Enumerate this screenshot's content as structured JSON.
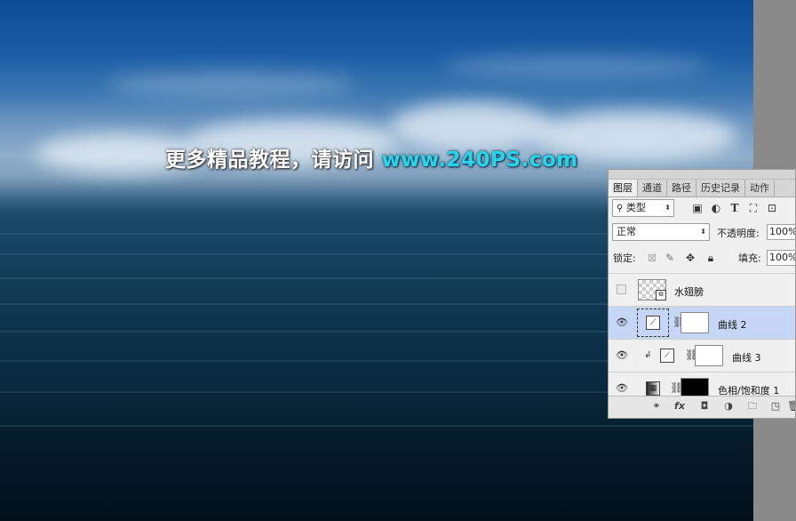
{
  "watermark": {
    "text_cn": "更多精品教程，请访问",
    "text_url": "www.240PS.com"
  },
  "panel": {
    "tabs": [
      {
        "label": "图层",
        "active": true
      },
      {
        "label": "通道"
      },
      {
        "label": "路径"
      },
      {
        "label": "历史记录"
      },
      {
        "label": "动作"
      }
    ],
    "filter": {
      "search_icon": "search-icon",
      "value": "类型"
    },
    "filter_icons": [
      "image-filter-icon",
      "adjustment-filter-icon",
      "type-filter-icon",
      "shape-filter-icon",
      "smartobject-filter-icon"
    ],
    "blend_mode": "正常",
    "opacity_label": "不透明度:",
    "opacity_value": "100%",
    "lock_label": "锁定:",
    "lock_icons": [
      "lock-transparent-icon",
      "lock-image-icon",
      "lock-position-icon",
      "lock-all-icon"
    ],
    "fill_label": "填充:",
    "fill_value": "100%",
    "layers": [
      {
        "name": "水翅膀",
        "visible": false,
        "type": "smart-object"
      },
      {
        "name": "曲线 2",
        "visible": true,
        "type": "curves",
        "selected": true
      },
      {
        "name": "曲线 3",
        "visible": true,
        "type": "curves",
        "clipped": true
      },
      {
        "name": "色相/饱和度 1",
        "visible": true,
        "type": "hue-saturation"
      }
    ],
    "footer_icons": [
      "link-icon",
      "fx-icon",
      "mask-icon",
      "adjustment-icon",
      "folder-icon",
      "new-layer-icon",
      "trash-icon"
    ],
    "footer_fx_label": "fx"
  }
}
